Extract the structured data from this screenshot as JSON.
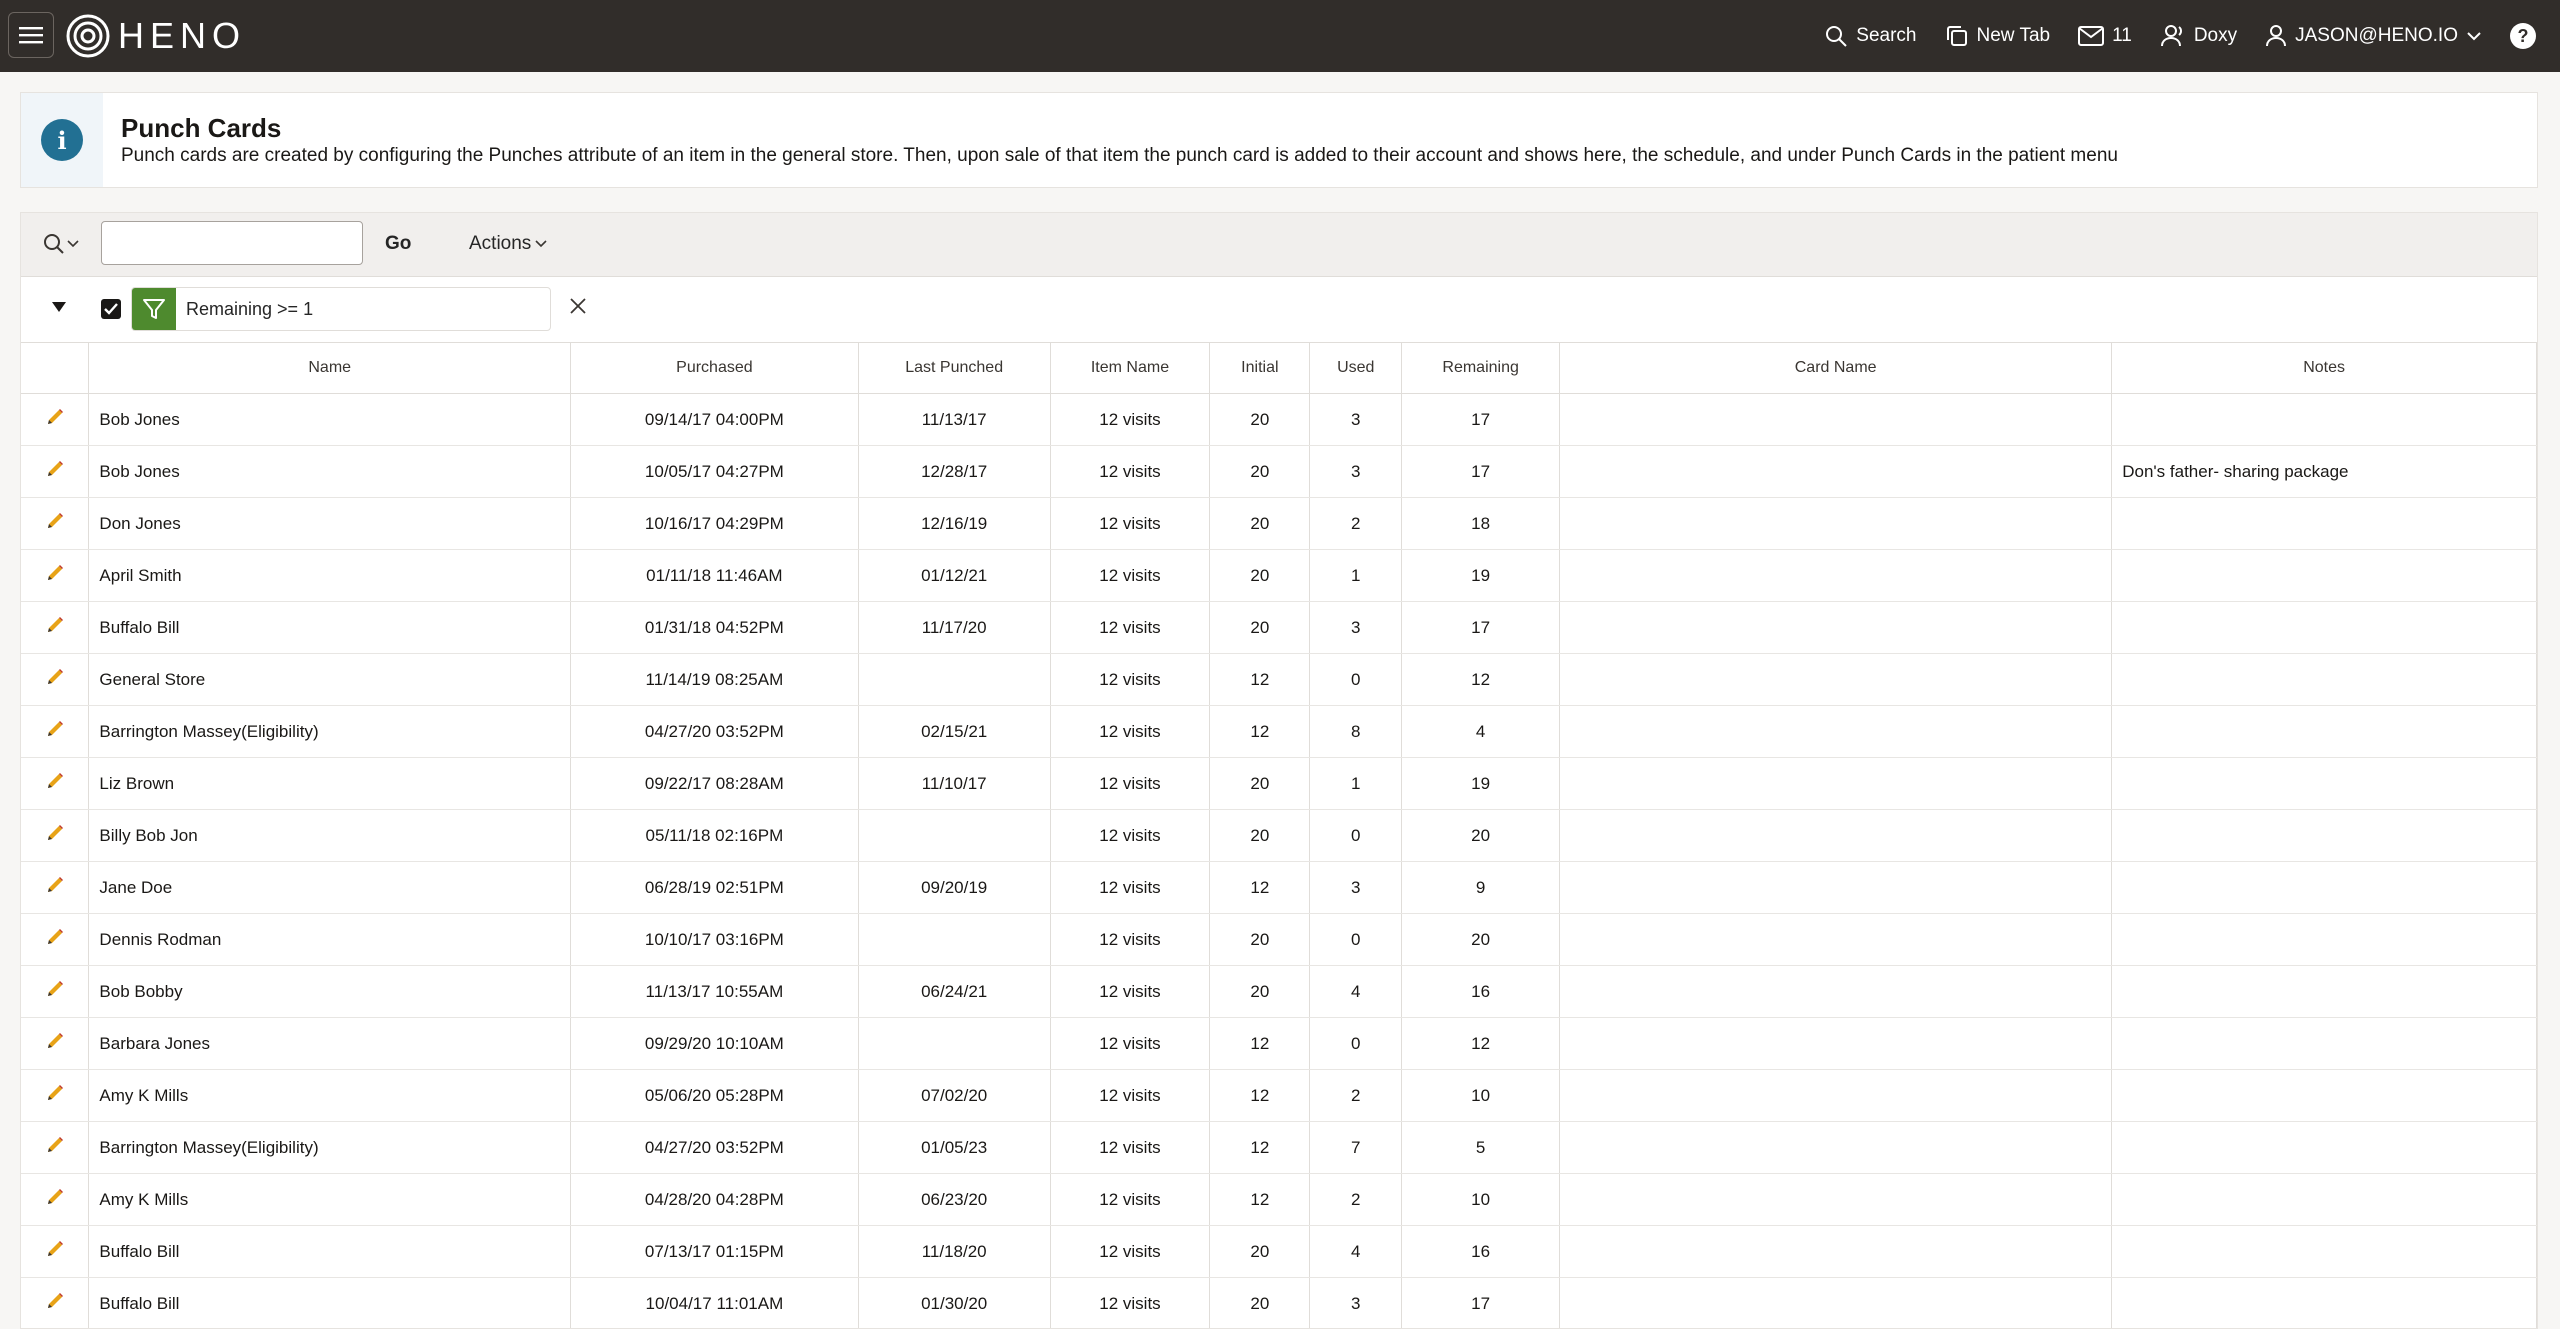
{
  "header": {
    "logo_text": "HENO",
    "nav": {
      "search_label": "Search",
      "new_tab_label": "New Tab",
      "messages_count": "11",
      "doxy_label": "Doxy",
      "user_label": "JASON@HENO.IO",
      "help_label": "?"
    }
  },
  "info": {
    "title": "Punch Cards",
    "text": "Punch cards are created by configuring the Punches attribute of an item in the general store. Then, upon sale of that item the punch card is added to their account and shows here, the schedule, and under Punch Cards in the patient menu"
  },
  "toolbar": {
    "search_value": "",
    "go_label": "Go",
    "actions_label": "Actions"
  },
  "filter": {
    "checked": true,
    "text": "Remaining >= 1"
  },
  "table": {
    "columns": [
      "",
      "Name",
      "Purchased",
      "Last Punched",
      "Item Name",
      "Initial",
      "Used",
      "Remaining",
      "Card Name",
      "Notes"
    ],
    "rows": [
      {
        "name": "Bob Jones",
        "purchased": "09/14/17 04:00PM",
        "last_punched": "11/13/17",
        "item_name": "12 visits",
        "initial": "20",
        "used": "3",
        "remaining": "17",
        "card_name": "",
        "notes": ""
      },
      {
        "name": "Bob Jones",
        "purchased": "10/05/17 04:27PM",
        "last_punched": "12/28/17",
        "item_name": "12 visits",
        "initial": "20",
        "used": "3",
        "remaining": "17",
        "card_name": "",
        "notes": "Don's father- sharing package"
      },
      {
        "name": "Don Jones",
        "purchased": "10/16/17 04:29PM",
        "last_punched": "12/16/19",
        "item_name": "12 visits",
        "initial": "20",
        "used": "2",
        "remaining": "18",
        "card_name": "",
        "notes": ""
      },
      {
        "name": "April Smith",
        "purchased": "01/11/18 11:46AM",
        "last_punched": "01/12/21",
        "item_name": "12 visits",
        "initial": "20",
        "used": "1",
        "remaining": "19",
        "card_name": "",
        "notes": ""
      },
      {
        "name": "Buffalo Bill",
        "purchased": "01/31/18 04:52PM",
        "last_punched": "11/17/20",
        "item_name": "12 visits",
        "initial": "20",
        "used": "3",
        "remaining": "17",
        "card_name": "",
        "notes": ""
      },
      {
        "name": "General Store",
        "purchased": "11/14/19 08:25AM",
        "last_punched": "",
        "item_name": "12 visits",
        "initial": "12",
        "used": "0",
        "remaining": "12",
        "card_name": "",
        "notes": ""
      },
      {
        "name": "Barrington Massey(Eligibility)",
        "purchased": "04/27/20 03:52PM",
        "last_punched": "02/15/21",
        "item_name": "12 visits",
        "initial": "12",
        "used": "8",
        "remaining": "4",
        "card_name": "",
        "notes": ""
      },
      {
        "name": "Liz Brown",
        "purchased": "09/22/17 08:28AM",
        "last_punched": "11/10/17",
        "item_name": "12 visits",
        "initial": "20",
        "used": "1",
        "remaining": "19",
        "card_name": "",
        "notes": ""
      },
      {
        "name": "Billy Bob Jon",
        "purchased": "05/11/18 02:16PM",
        "last_punched": "",
        "item_name": "12 visits",
        "initial": "20",
        "used": "0",
        "remaining": "20",
        "card_name": "",
        "notes": ""
      },
      {
        "name": "Jane Doe",
        "purchased": "06/28/19 02:51PM",
        "last_punched": "09/20/19",
        "item_name": "12 visits",
        "initial": "12",
        "used": "3",
        "remaining": "9",
        "card_name": "",
        "notes": ""
      },
      {
        "name": "Dennis Rodman",
        "purchased": "10/10/17 03:16PM",
        "last_punched": "",
        "item_name": "12 visits",
        "initial": "20",
        "used": "0",
        "remaining": "20",
        "card_name": "",
        "notes": ""
      },
      {
        "name": "Bob Bobby",
        "purchased": "11/13/17 10:55AM",
        "last_punched": "06/24/21",
        "item_name": "12 visits",
        "initial": "20",
        "used": "4",
        "remaining": "16",
        "card_name": "",
        "notes": ""
      },
      {
        "name": "Barbara Jones",
        "purchased": "09/29/20 10:10AM",
        "last_punched": "",
        "item_name": "12 visits",
        "initial": "12",
        "used": "0",
        "remaining": "12",
        "card_name": "",
        "notes": ""
      },
      {
        "name": "Amy K Mills",
        "purchased": "05/06/20 05:28PM",
        "last_punched": "07/02/20",
        "item_name": "12 visits",
        "initial": "12",
        "used": "2",
        "remaining": "10",
        "card_name": "",
        "notes": ""
      },
      {
        "name": "Barrington Massey(Eligibility)",
        "purchased": "04/27/20 03:52PM",
        "last_punched": "01/05/23",
        "item_name": "12 visits",
        "initial": "12",
        "used": "7",
        "remaining": "5",
        "card_name": "",
        "notes": ""
      },
      {
        "name": "Amy K Mills",
        "purchased": "04/28/20 04:28PM",
        "last_punched": "06/23/20",
        "item_name": "12 visits",
        "initial": "12",
        "used": "2",
        "remaining": "10",
        "card_name": "",
        "notes": ""
      },
      {
        "name": "Buffalo Bill",
        "purchased": "07/13/17 01:15PM",
        "last_punched": "11/18/20",
        "item_name": "12 visits",
        "initial": "20",
        "used": "4",
        "remaining": "16",
        "card_name": "",
        "notes": ""
      },
      {
        "name": "Buffalo Bill",
        "purchased": "10/04/17 11:01AM",
        "last_punched": "01/30/20",
        "item_name": "12 visits",
        "initial": "20",
        "used": "3",
        "remaining": "17",
        "card_name": "",
        "notes": ""
      }
    ]
  },
  "colors": {
    "topbar": "#312d2a",
    "info_icon": "#227093",
    "filter_green": "#4e8a2e",
    "edit_pencil": "#e8a317"
  }
}
